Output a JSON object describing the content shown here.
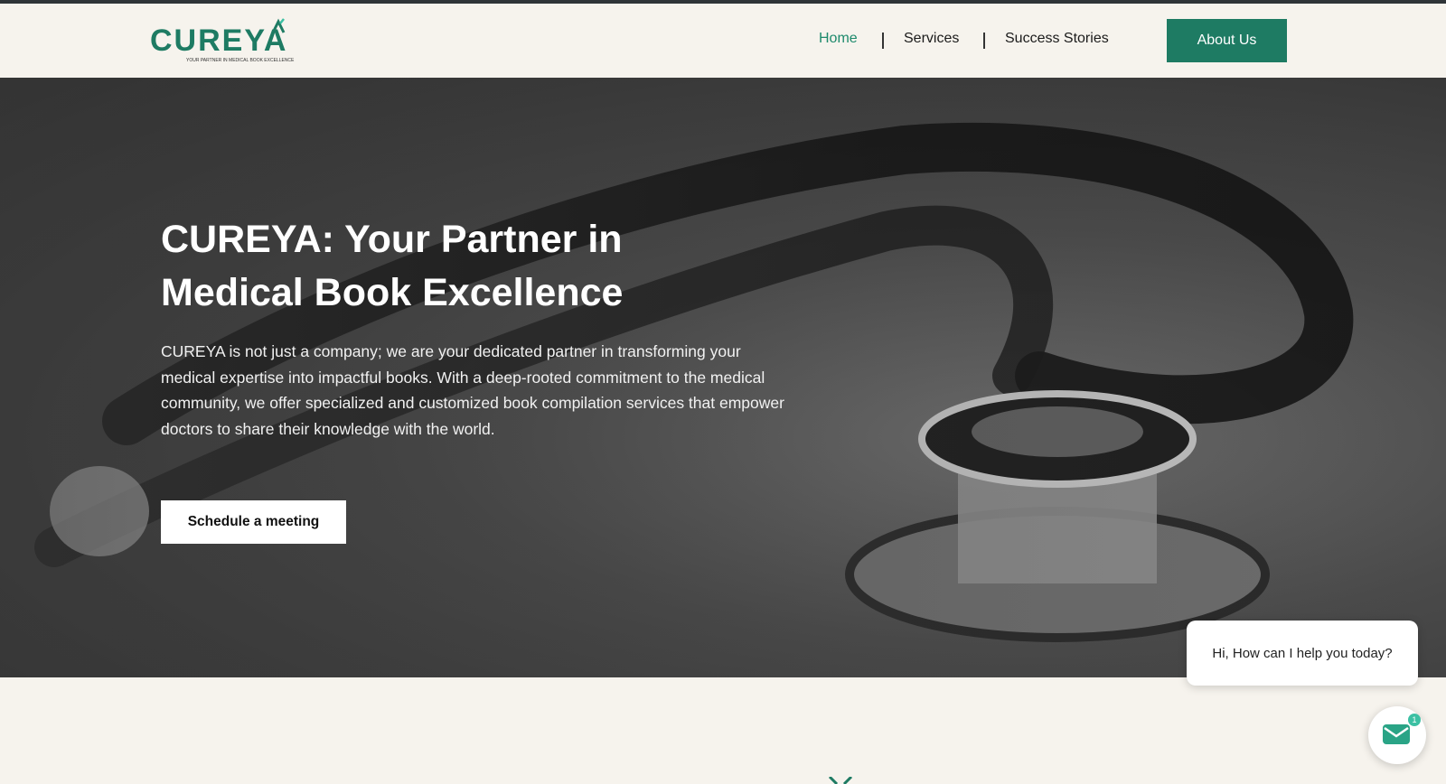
{
  "brand": {
    "logo_text": "CUREYA",
    "tagline": "YOUR PARTNER IN MEDICAL BOOK EXCELLENCE",
    "accent_color": "#1e7b63"
  },
  "nav": {
    "items": [
      {
        "label": "Home",
        "active": true
      },
      {
        "label": "Services",
        "active": false
      },
      {
        "label": "Success Stories",
        "active": false
      }
    ],
    "cta_label": "About Us"
  },
  "hero": {
    "title": "CUREYA: Your Partner in Medical Book Excellence",
    "description": "CUREYA is not just a company; we are your dedicated partner in transforming your medical expertise into impactful books. With a deep-rooted commitment to the medical community, we offer specialized and customized book compilation services that empower doctors to share their knowledge with the world.",
    "button_label": "Schedule a meeting"
  },
  "chat": {
    "greeting": "Hi, How can I help you today?",
    "badge_count": "1",
    "icon": "message-icon"
  }
}
